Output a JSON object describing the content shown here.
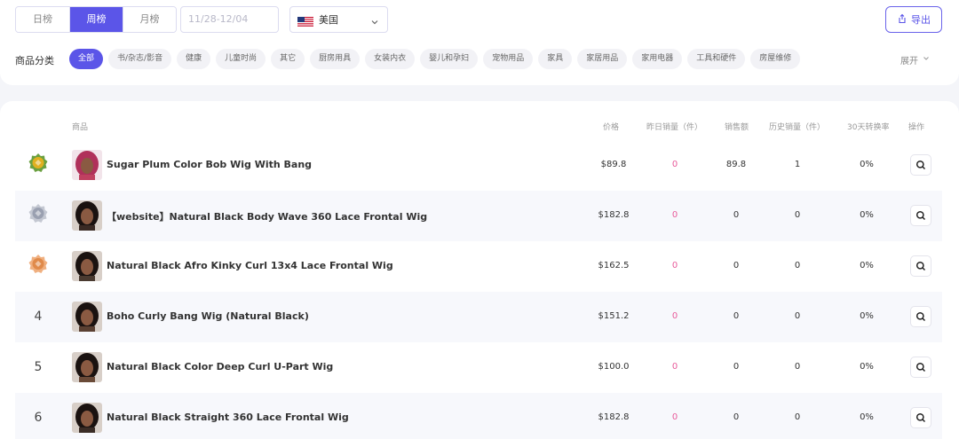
{
  "tabs": [
    "日榜",
    "周榜",
    "月榜"
  ],
  "active_tab": 1,
  "date_placeholder": "11/28-12/04",
  "country": {
    "label": "美国",
    "icon": "us-flag-icon"
  },
  "export_label": "导出",
  "category_label": "商品分类",
  "categories": [
    "全部",
    "书/杂志/影音",
    "健康",
    "儿童时尚",
    "其它",
    "厨房用具",
    "女装内衣",
    "婴儿和孕妇",
    "宠物用品",
    "家具",
    "家居用品",
    "家用电器",
    "工具和硬件",
    "房屋维修"
  ],
  "expand_label": "展开",
  "columns": {
    "product": "商品",
    "price": "价格",
    "yesterday_sales": "昨日销量（件）",
    "revenue": "销售额",
    "history_sales": "历史销量（件）",
    "conversion": "30天转换率",
    "action": "操作"
  },
  "rows": [
    {
      "rank": "",
      "medal": "gold",
      "title": "Sugar Plum Color Bob Wig With Bang",
      "price": "$89.8",
      "yesterday": "0",
      "revenue": "89.8",
      "history": "1",
      "conversion": "0%"
    },
    {
      "rank": "",
      "medal": "silver",
      "title": "【website】Natural Black Body Wave 360 Lace Frontal Wig",
      "price": "$182.8",
      "yesterday": "0",
      "revenue": "0",
      "history": "0",
      "conversion": "0%"
    },
    {
      "rank": "",
      "medal": "bronze",
      "title": "Natural Black Afro Kinky Curl 13x4 Lace Frontal Wig",
      "price": "$162.5",
      "yesterday": "0",
      "revenue": "0",
      "history": "0",
      "conversion": "0%"
    },
    {
      "rank": "4",
      "medal": "",
      "title": "Boho Curly Bang Wig (Natural Black)",
      "price": "$151.2",
      "yesterday": "0",
      "revenue": "0",
      "history": "0",
      "conversion": "0%"
    },
    {
      "rank": "5",
      "medal": "",
      "title": "Natural Black Color Deep Curl U-Part Wig",
      "price": "$100.0",
      "yesterday": "0",
      "revenue": "0",
      "history": "0",
      "conversion": "0%"
    },
    {
      "rank": "6",
      "medal": "",
      "title": "Natural Black Straight 360 Lace Frontal Wig",
      "price": "$182.8",
      "yesterday": "0",
      "revenue": "0",
      "history": "0",
      "conversion": "0%"
    }
  ],
  "colors": {
    "accent": "#5b55e8",
    "pink": "#e85a9a",
    "gold": "#e0b020",
    "silver": "#9aa0b0",
    "bronze": "#e08a4a"
  }
}
